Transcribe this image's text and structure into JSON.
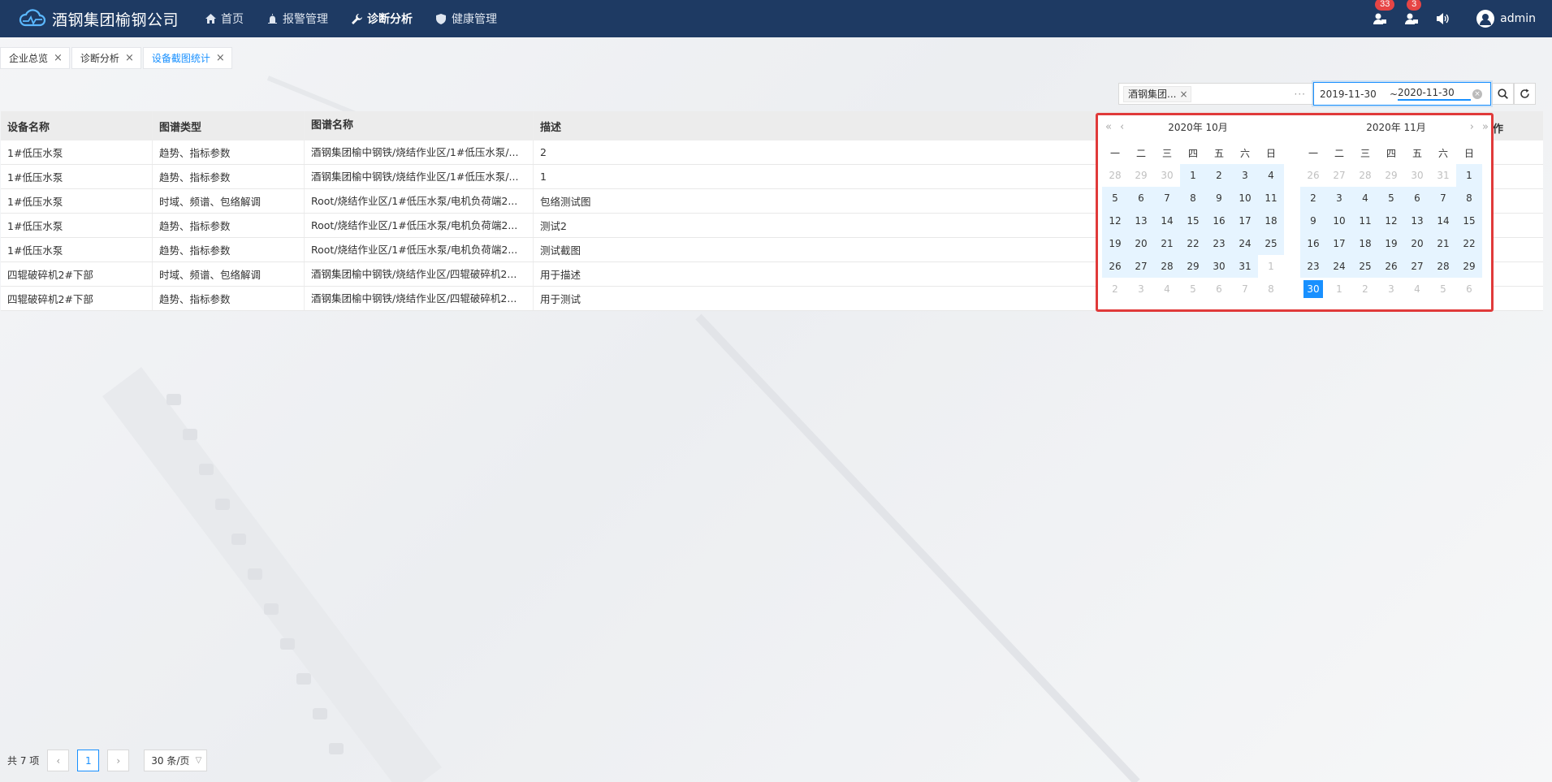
{
  "header": {
    "title": "酒钢集团榆钢公司",
    "nav": [
      {
        "label": "首页",
        "icon": "home-icon"
      },
      {
        "label": "报警管理",
        "icon": "alarm-icon"
      },
      {
        "label": "诊断分析",
        "icon": "wrench-icon",
        "active": true
      },
      {
        "label": "健康管理",
        "icon": "shield-icon"
      }
    ],
    "badges": {
      "messages": "33",
      "alerts": "3"
    },
    "user": "admin"
  },
  "tabs": [
    {
      "label": "企业总览"
    },
    {
      "label": "诊断分析"
    },
    {
      "label": "设备截图统计",
      "active": true
    }
  ],
  "filter": {
    "tag": "酒钢集团...",
    "more": "···"
  },
  "range": {
    "start": "2019-11-30",
    "separator": "~",
    "end": "2020-11-30"
  },
  "table": {
    "headers": [
      "设备名称",
      "图谱类型",
      "图谱名称",
      "描述"
    ],
    "op_header_partial": "作",
    "rows": [
      [
        "1#低压水泵",
        "趋势、指标参数",
        "酒钢集团榆中钢铁/烧结作业区/1#低压水泵/...",
        "2"
      ],
      [
        "1#低压水泵",
        "趋势、指标参数",
        "酒钢集团榆中钢铁/烧结作业区/1#低压水泵/...",
        "1"
      ],
      [
        "1#低压水泵",
        "时域、频谱、包络解调",
        "Root/烧结作业区/1#低压水泵/电机负荷端2...",
        "包络测试图"
      ],
      [
        "1#低压水泵",
        "趋势、指标参数",
        "Root/烧结作业区/1#低压水泵/电机负荷端2...",
        "测试2"
      ],
      [
        "1#低压水泵",
        "趋势、指标参数",
        "Root/烧结作业区/1#低压水泵/电机负荷端2...",
        "测试截图"
      ],
      [
        "四辊破碎机2#下部",
        "时域、频谱、包络解调",
        "酒钢集团榆中钢铁/烧结作业区/四辊破碎机2...",
        "用于描述"
      ],
      [
        "四辊破碎机2#下部",
        "趋势、指标参数",
        "酒钢集团榆中钢铁/烧结作业区/四辊破碎机2...",
        "用于测试"
      ]
    ]
  },
  "calendar": {
    "weekdays": [
      "一",
      "二",
      "三",
      "四",
      "五",
      "六",
      "日"
    ],
    "left": {
      "title": "2020年 10月",
      "days": [
        "28",
        "29",
        "30",
        "1",
        "2",
        "3",
        "4",
        "5",
        "6",
        "7",
        "8",
        "9",
        "10",
        "11",
        "12",
        "13",
        "14",
        "15",
        "16",
        "17",
        "18",
        "19",
        "20",
        "21",
        "22",
        "23",
        "24",
        "25",
        "26",
        "27",
        "28",
        "29",
        "30",
        "31",
        "1",
        "2",
        "3",
        "4",
        "5",
        "6",
        "7",
        "8"
      ],
      "month_start": 3,
      "month_end": 33
    },
    "right": {
      "title": "2020年 11月",
      "days": [
        "26",
        "27",
        "28",
        "29",
        "30",
        "31",
        "1",
        "2",
        "3",
        "4",
        "5",
        "6",
        "7",
        "8",
        "9",
        "10",
        "11",
        "12",
        "13",
        "14",
        "15",
        "16",
        "17",
        "18",
        "19",
        "20",
        "21",
        "22",
        "23",
        "24",
        "25",
        "26",
        "27",
        "28",
        "29",
        "30",
        "1",
        "2",
        "3",
        "4",
        "5",
        "6"
      ],
      "month_start": 6,
      "month_end": 35,
      "selected": 35
    }
  },
  "pagination": {
    "total": "共 7 项",
    "page": "1",
    "size": "30 条/页"
  }
}
